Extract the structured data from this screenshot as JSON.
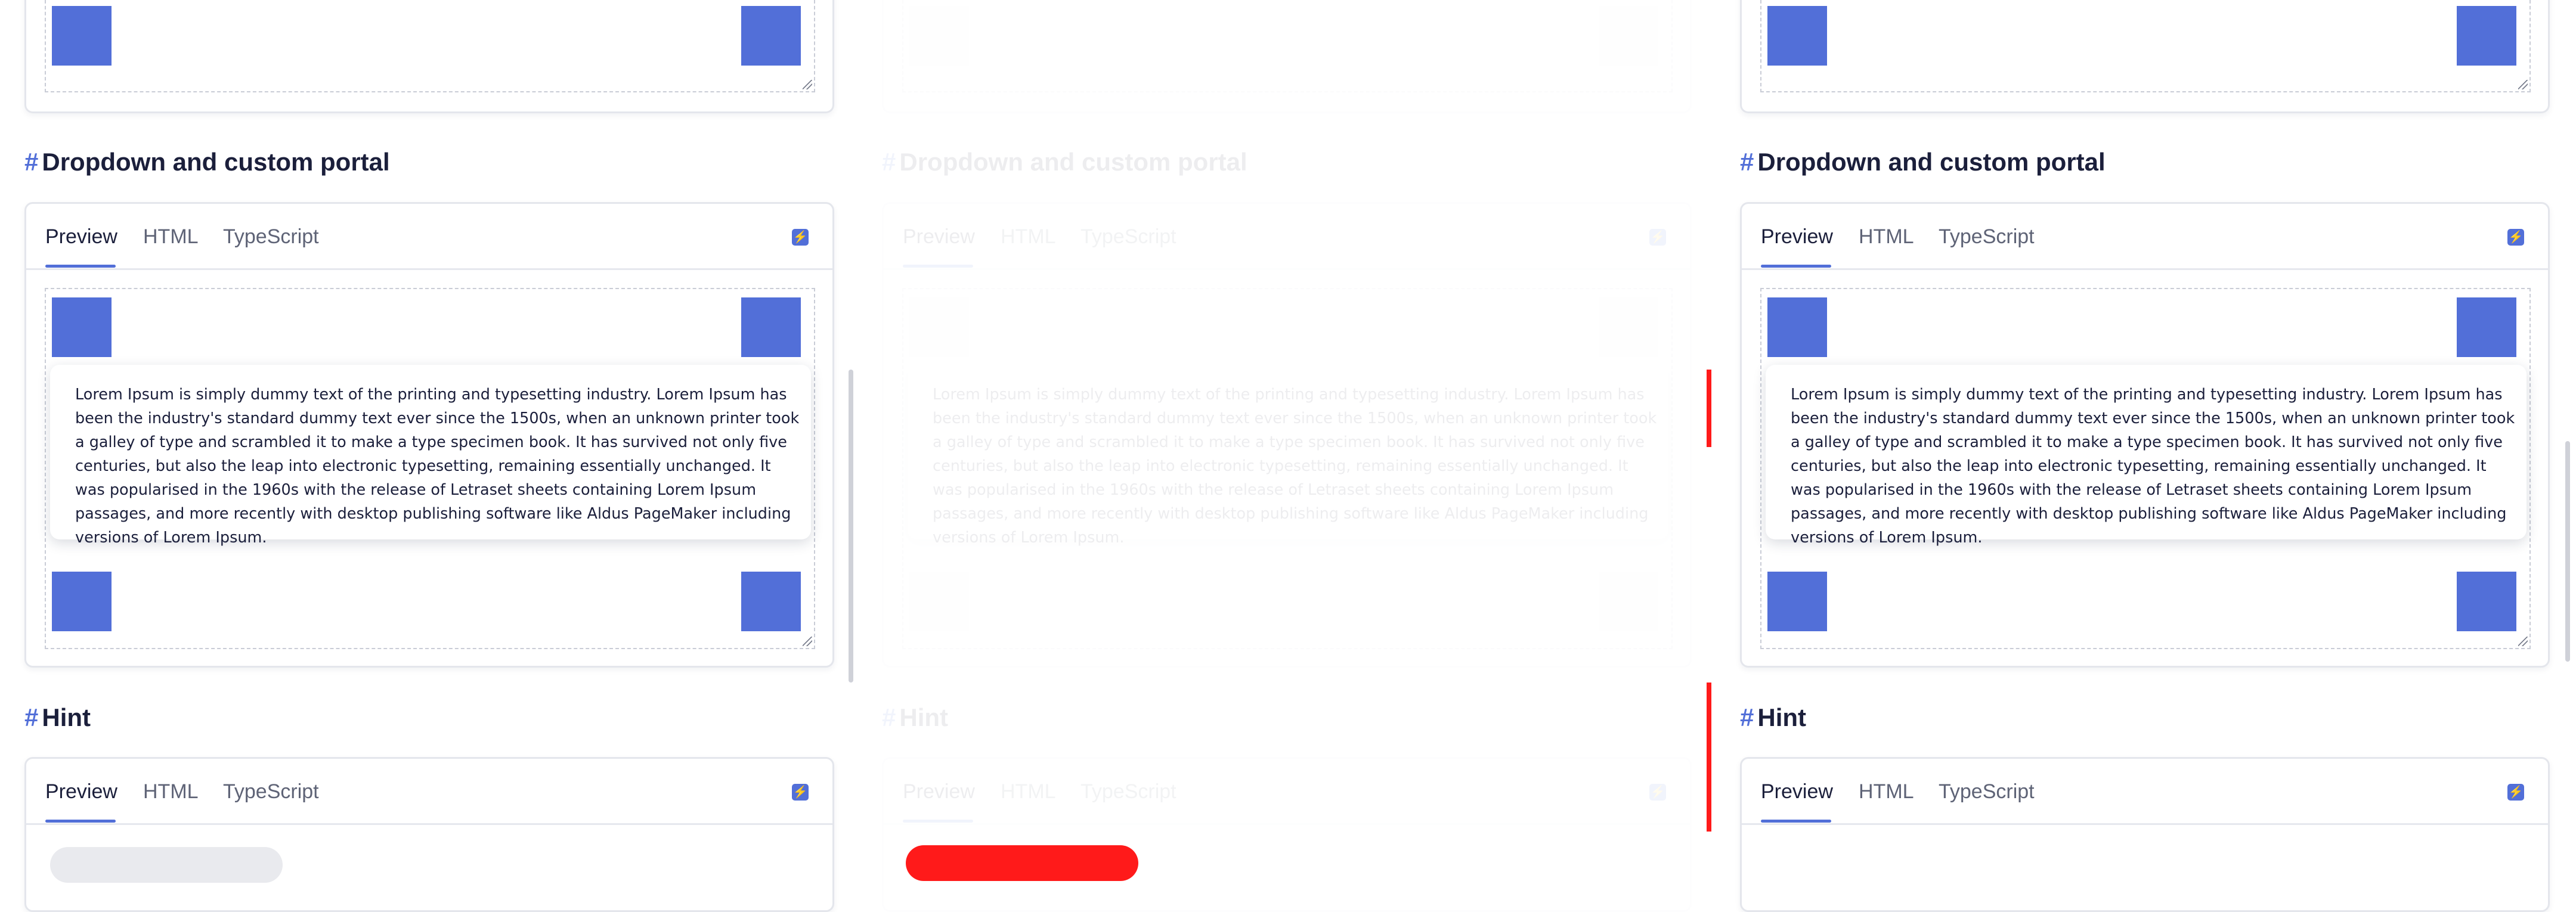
{
  "sections": {
    "dropdown": {
      "hash": "#",
      "title": "Dropdown and custom portal"
    },
    "hint": {
      "hash": "#",
      "title": "Hint"
    }
  },
  "tabs": {
    "preview": "Preview",
    "html": "HTML",
    "typescript": "TypeScript"
  },
  "popover_text": "Lorem Ipsum is simply dummy text of the printing and typesetting industry. Lorem Ipsum has been the industry's standard dummy text ever since the 1500s, when an unknown printer took a galley of type and scrambled it to make a type specimen book. It has survived not only five centuries, but also the leap into electronic typesetting, remaining essentially unchanged. It was popularised in the 1960s with the release of Letraset sheets containing Lorem Ipsum passages, and more recently with desktop publishing software like Aldus PageMaker including versions of Lorem Ipsum.",
  "icons": {
    "stackblitz": "lightning-icon",
    "resize": "resize-grip-icon"
  },
  "colors": {
    "accent": "#526fd8",
    "highlight": "#ff1a1a"
  }
}
